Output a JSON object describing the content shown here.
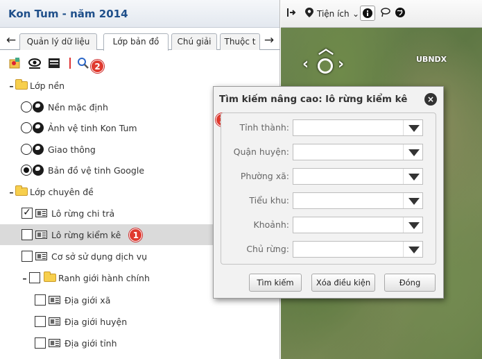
{
  "app_title": "Kon Tum - năm 2014",
  "tabs": [
    {
      "label": "Quản lý dữ liệu"
    },
    {
      "label": "Lớp bản đồ"
    },
    {
      "label": "Chú giải"
    },
    {
      "label": "Thuộc t"
    }
  ],
  "tab_nav": {
    "prev": "←",
    "next": "→"
  },
  "toolbar": {
    "badge": "2"
  },
  "tree": {
    "base_group": {
      "toggle": "–",
      "label": "Lớp nền"
    },
    "base_layers": [
      {
        "label": "Nền mặc định",
        "selected": false
      },
      {
        "label": "Ảnh vệ tinh Kon Tum",
        "selected": false
      },
      {
        "label": "Giao thông",
        "selected": false
      },
      {
        "label": "Bản đồ vệ tinh Google",
        "selected": true
      }
    ],
    "thematic_group": {
      "toggle": "–",
      "label": "Lớp chuyên đề"
    },
    "thematic_layers": [
      {
        "label": "Lô rừng chi trả",
        "checked": true,
        "check_mark": "✓"
      },
      {
        "label": "Lô rừng kiểm kê",
        "checked": false,
        "badge": "1"
      },
      {
        "label": "Cơ sở sử dụng dịch vụ",
        "checked": false
      }
    ],
    "admin_group": {
      "toggle": "–",
      "label": "Ranh giới hành chính"
    },
    "admin_layers": [
      {
        "label": "Địa giới xã"
      },
      {
        "label": "Địa giới huyện"
      },
      {
        "label": "Địa giới tỉnh"
      }
    ]
  },
  "map_toolbar": {
    "utilities_label": "Tiện ích"
  },
  "map_labels": [
    "UBNDX",
    "UBNDX"
  ],
  "dialog": {
    "title": "Tìm kiếm nâng cao: lô rừng kiểm kê",
    "close_symbol": "×",
    "badge": "3",
    "fields": [
      {
        "label": "Tỉnh thành:",
        "value": ""
      },
      {
        "label": "Quận huyện:",
        "value": ""
      },
      {
        "label": "Phường xã:",
        "value": ""
      },
      {
        "label": "Tiểu khu:",
        "value": ""
      },
      {
        "label": "Khoảnh:",
        "value": ""
      },
      {
        "label": "Chủ rừng:",
        "value": ""
      }
    ],
    "buttons": {
      "search": "Tìm kiếm",
      "clear": "Xóa điều kiện",
      "close": "Đóng"
    }
  },
  "colors": {
    "accent_title": "#1f4f8a",
    "badge": "#e03a2f",
    "highlight_row": "#dadada"
  }
}
